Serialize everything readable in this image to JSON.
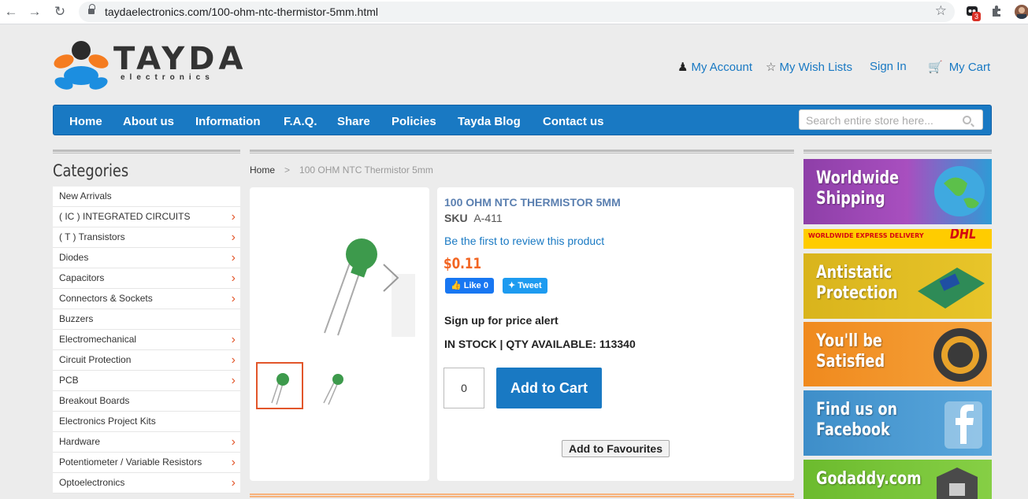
{
  "browser": {
    "url": "taydaelectronics.com/100-ohm-ntc-thermistor-5mm.html",
    "ext_badge": "3"
  },
  "header": {
    "logo_word": "TAYDA",
    "logo_sub": "electronics",
    "my_account": "My Account",
    "wish_lists": "My Wish Lists",
    "sign_in": "Sign In",
    "my_cart": "My Cart"
  },
  "nav": {
    "items": [
      "Home",
      "About us",
      "Information",
      "F.A.Q.",
      "Share",
      "Policies",
      "Tayda Blog",
      "Contact us"
    ],
    "search_placeholder": "Search entire store here..."
  },
  "sidebar": {
    "title": "Categories",
    "items": [
      {
        "label": "New Arrivals",
        "sub": false
      },
      {
        "label": "( IC ) INTEGRATED CIRCUITS",
        "sub": true
      },
      {
        "label": "( T ) Transistors",
        "sub": true
      },
      {
        "label": "Diodes",
        "sub": true
      },
      {
        "label": "Capacitors",
        "sub": true
      },
      {
        "label": "Connectors & Sockets",
        "sub": true
      },
      {
        "label": "Buzzers",
        "sub": false
      },
      {
        "label": "Electromechanical",
        "sub": true
      },
      {
        "label": "Circuit Protection",
        "sub": true
      },
      {
        "label": "PCB",
        "sub": true
      },
      {
        "label": "Breakout Boards",
        "sub": false
      },
      {
        "label": "Electronics Project Kits",
        "sub": false
      },
      {
        "label": "Hardware",
        "sub": true
      },
      {
        "label": "Potentiometer / Variable Resistors",
        "sub": true
      },
      {
        "label": "Optoelectronics",
        "sub": true
      }
    ]
  },
  "breadcrumb": {
    "home": "Home",
    "sep": ">",
    "current": "100 OHM NTC Thermistor 5mm"
  },
  "product": {
    "title": "100 OHM NTC THERMISTOR 5MM",
    "sku_label": "SKU",
    "sku": "A-411",
    "review": "Be the first to review this product",
    "price": "$0.11",
    "fb_like": "Like 0",
    "tweet": "Tweet",
    "price_alert": "Sign up for price alert",
    "stock": "IN STOCK | QTY AVAILABLE: 113340",
    "qty": "0",
    "add_to_cart": "Add to Cart",
    "add_to_fav": "Add to Favourites"
  },
  "banners": [
    {
      "line1": "Worldwide",
      "line2": "Shipping",
      "color": "#8e3fa8"
    },
    {
      "text": "WORLDWIDE EXPRESS DELIVERY",
      "brand": "DHL",
      "color": "#ffcc00"
    },
    {
      "line1": "Antistatic",
      "line2": "Protection",
      "color": "#d9b41c"
    },
    {
      "line1": "You'll be",
      "line2": "Satisfied",
      "color": "#f08a1e"
    },
    {
      "line1": "Find us on",
      "line2": "Facebook",
      "color": "#3e8ec9"
    },
    {
      "line1": "Godaddy.com",
      "line2": "",
      "color": "#6cbb2e"
    }
  ],
  "colors": {
    "accent": "#1979c3",
    "price": "#f26522"
  }
}
